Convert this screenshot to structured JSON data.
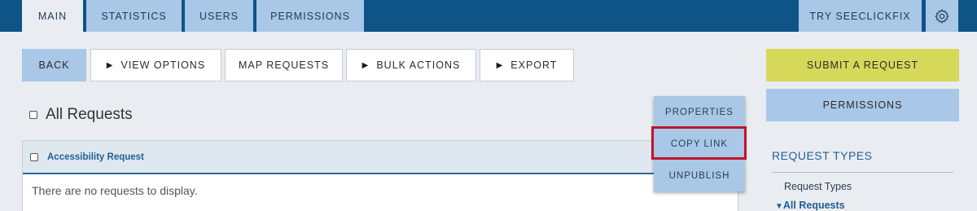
{
  "nav": {
    "tabs": [
      "MAIN",
      "STATISTICS",
      "USERS",
      "PERMISSIONS"
    ],
    "try_label": "TRY SEECLICKFIX",
    "settings_icon": "gear-icon"
  },
  "toolbar": {
    "back": "BACK",
    "view_options": "VIEW OPTIONS",
    "map_requests": "MAP REQUESTS",
    "bulk_actions": "BULK ACTIONS",
    "export": "EXPORT",
    "caret": "▶"
  },
  "sidebar": {
    "submit": "SUBMIT A REQUEST",
    "permissions": "PERMISSIONS",
    "section_title": "REQUEST TYPES",
    "links": [
      "Request Types",
      "All Requests"
    ],
    "expand_caret": "▼"
  },
  "main": {
    "heading": "All Requests",
    "table_header": "Accessibility Request",
    "empty_text": "There are no requests to display."
  },
  "menu": {
    "items": [
      "PROPERTIES",
      "COPY LINK",
      "UNPUBLISH"
    ]
  },
  "colors": {
    "nav_bg": "#0e5487",
    "tab_bg": "#a9c7e6",
    "submit_bg": "#d6d85a",
    "highlight": "#c0142b"
  }
}
